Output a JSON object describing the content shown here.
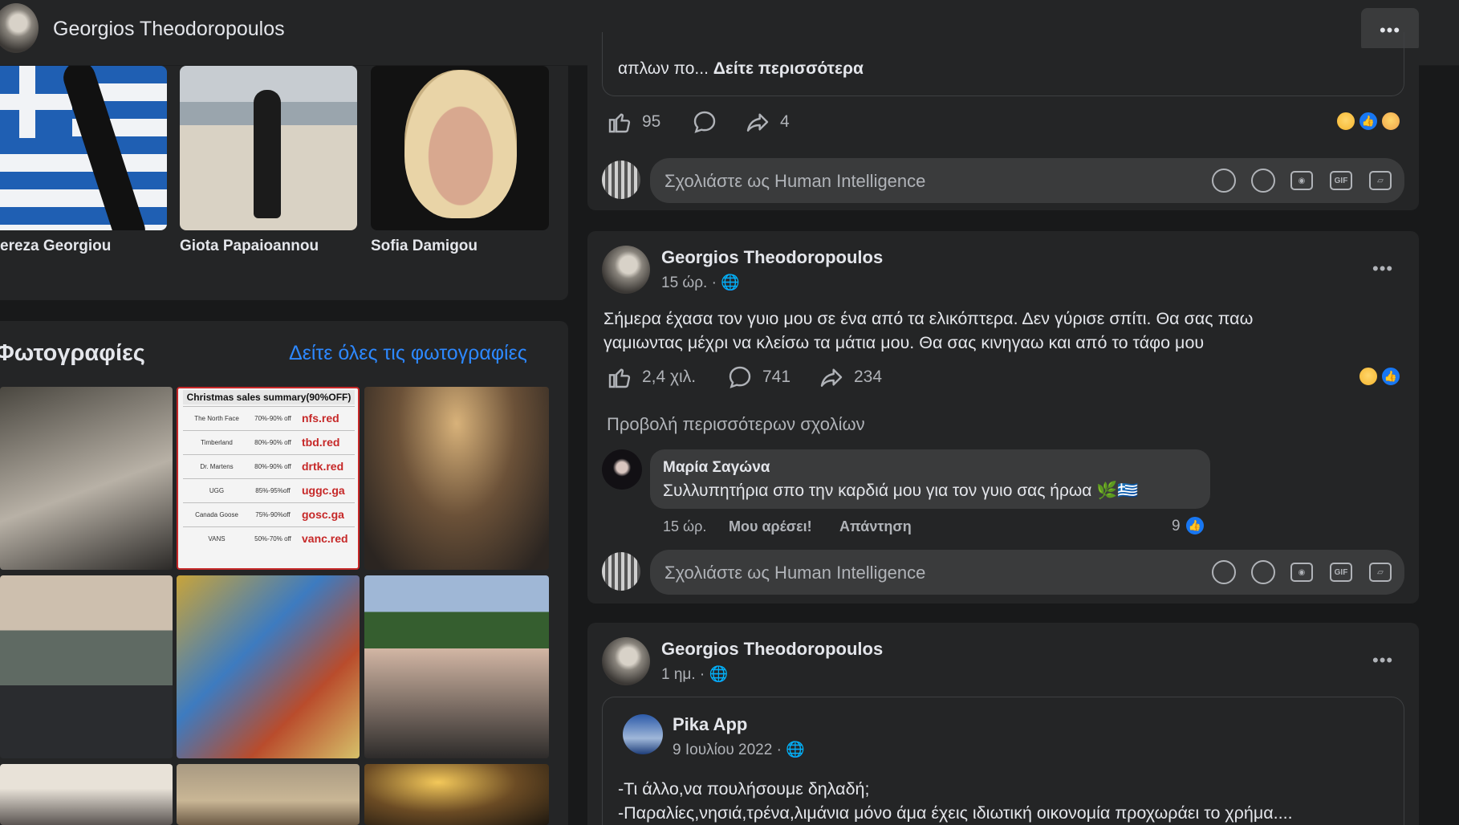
{
  "header": {
    "name": "Georgios Theodoropoulos",
    "more_label": "•••"
  },
  "friends": [
    {
      "name": "ereza Georgiou"
    },
    {
      "name": "Giota Papaioannou"
    },
    {
      "name": "Sofia Damigou"
    }
  ],
  "photos": {
    "title": "Φωτογραφίες",
    "see_all": "Δείτε όλες τις φωτογραφίες",
    "sales_sheet": {
      "title": "Christmas sales summary(90%OFF)",
      "rows": [
        {
          "brand": "The North Face",
          "pct": "70%-90% off",
          "site": "nfs.red"
        },
        {
          "brand": "Timberland",
          "pct": "80%-90% off",
          "site": "tbd.red"
        },
        {
          "brand": "Dr. Martens",
          "pct": "80%-90% off",
          "site": "drtk.red"
        },
        {
          "brand": "UGG",
          "pct": "85%-95%off",
          "site": "uggc.ga"
        },
        {
          "brand": "Canada Goose",
          "pct": "75%-90%off",
          "site": "gosc.ga"
        },
        {
          "brand": "VANS",
          "pct": "50%-70% off",
          "site": "vanc.red"
        }
      ]
    }
  },
  "post1": {
    "embed_text_start": "απλων πο...",
    "embed_see_more": "Δείτε περισσότερα",
    "likes": "95",
    "shares": "4",
    "comment_placeholder": "Σχολιάστε ως Human Intelligence"
  },
  "post2": {
    "author": "Georgios Theodoropoulos",
    "time": "15 ώρ. ·",
    "text_line1": "Σήμερα έχασα τον γυιο μου σε ένα από τα ελικόπτερα. Δεν γύρισε σπίτι. Θα σας παω",
    "text_line2": "γαμιωντας μέχρι να κλείσω τα μάτια μου. Θα σας κινηγαω και από το τάφο μου",
    "likes": "2,4 χιλ.",
    "comments": "741",
    "shares": "234",
    "view_more": "Προβολή περισσότερων σχολίων",
    "comment": {
      "author": "Μαρία Σαγώνα",
      "text": "Συλλυπητήρια σπο την καρδιά μου για τον γυιο σας ήρωα 🌿🇬🇷",
      "time": "15 ώρ.",
      "like_action": "Μου αρέσει!",
      "reply_action": "Απάντηση",
      "reaction_count": "9"
    },
    "comment_placeholder": "Σχολιάστε ως Human Intelligence"
  },
  "post3": {
    "author": "Georgios Theodoropoulos",
    "time": "1 ημ. ·",
    "shared_page": "Pika App",
    "shared_date": "9 Ιουλίου 2022 ·",
    "line1": "-Τι άλλο,να πουλήσουμε δηλαδή;",
    "line2": "-Παραλίες,νησιά,τρένα,λιμάνια μόνο άμα έχεις ιδιωτική οικονομία προχωράει το χρήμα...."
  },
  "icons": [
    "like-icon",
    "comment-icon",
    "share-icon",
    "globe-icon",
    "avatar-sticker-icon",
    "emoji-icon",
    "camera-icon",
    "gif-icon",
    "sticker-icon",
    "more-icon"
  ],
  "colors": {
    "background": "#18191a",
    "card": "#242526",
    "link": "#2d88ff",
    "like_blue": "#1877f2"
  }
}
